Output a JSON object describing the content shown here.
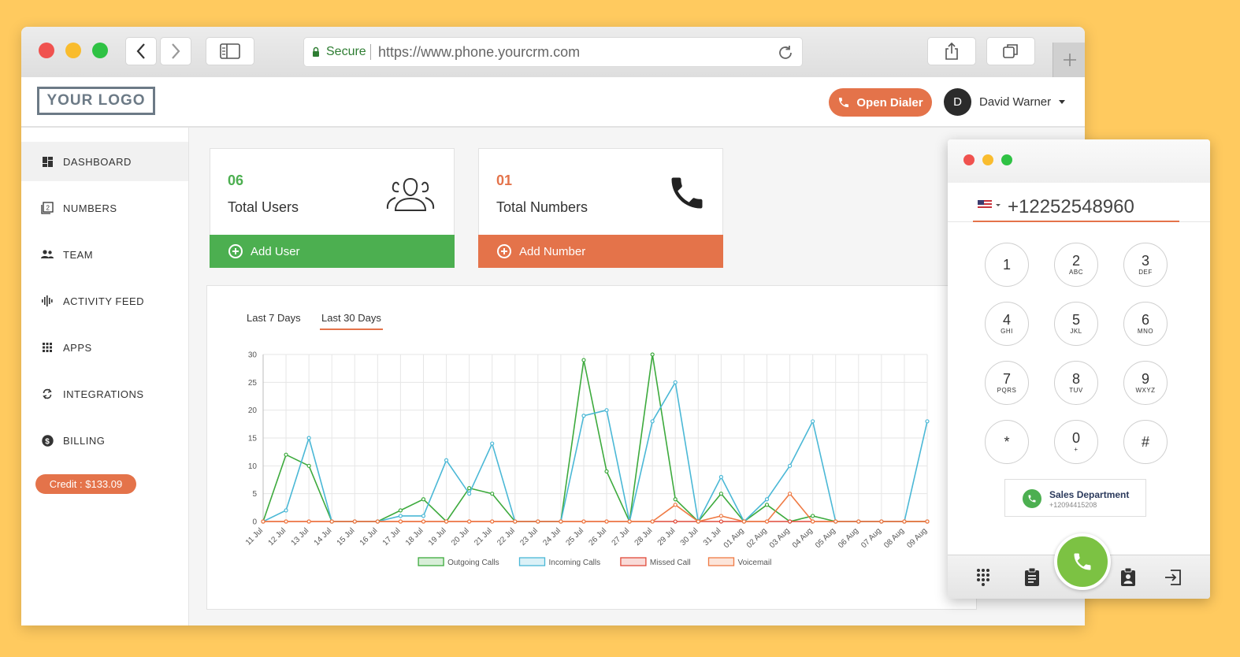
{
  "browser": {
    "secure_label": "Secure",
    "url": "https://www.phone.yourcrm.com"
  },
  "header": {
    "logo": "YOUR LOGO",
    "open_dialer": "Open Dialer",
    "avatar_initial": "D",
    "user_name": "David Warner"
  },
  "sidebar": {
    "items": [
      {
        "label": "DASHBOARD",
        "icon": "dashboard-icon"
      },
      {
        "label": "NUMBERS",
        "icon": "numbers-icon"
      },
      {
        "label": "TEAM",
        "icon": "team-icon"
      },
      {
        "label": "ACTIVITY FEED",
        "icon": "activity-icon"
      },
      {
        "label": "APPS",
        "icon": "apps-icon"
      },
      {
        "label": "INTEGRATIONS",
        "icon": "integrations-icon"
      },
      {
        "label": "BILLING",
        "icon": "billing-icon"
      }
    ],
    "credit": "Credit : $133.09"
  },
  "cards": {
    "users": {
      "count": "06",
      "label": "Total Users",
      "action": "Add User",
      "color": "#4CAF50"
    },
    "numbers": {
      "count": "01",
      "label": "Total Numbers",
      "action": "Add Number",
      "color": "#E4734A"
    }
  },
  "chart_tabs": [
    "Last 7 Days",
    "Last 30 Days"
  ],
  "chart_data": {
    "type": "line",
    "title": "",
    "xlabel": "",
    "ylabel": "",
    "ylim": [
      0,
      30
    ],
    "yticks": [
      0,
      5,
      10,
      15,
      20,
      25,
      30
    ],
    "grid": true,
    "legend": "bottom",
    "categories": [
      "11 Jul",
      "12 Jul",
      "13 Jul",
      "14 Jul",
      "15 Jul",
      "16 Jul",
      "17 Jul",
      "18 Jul",
      "19 Jul",
      "20 Jul",
      "21 Jul",
      "22 Jul",
      "23 Jul",
      "24 Jul",
      "25 Jul",
      "26 Jul",
      "27 Jul",
      "28 Jul",
      "29 Jul",
      "30 Jul",
      "31 Jul",
      "01 Aug",
      "02 Aug",
      "03 Aug",
      "04 Aug",
      "05 Aug",
      "06 Aug",
      "07 Aug",
      "08 Aug",
      "09 Aug"
    ],
    "series": [
      {
        "name": "Outgoing Calls",
        "color": "#3DAA3D",
        "values": [
          0,
          12,
          10,
          0,
          0,
          0,
          2,
          4,
          0,
          6,
          5,
          0,
          0,
          0,
          29,
          9,
          0,
          30,
          4,
          0,
          5,
          0,
          3,
          0,
          1,
          0,
          0,
          0,
          0,
          0
        ]
      },
      {
        "name": "Incoming Calls",
        "color": "#4BB8D6",
        "values": [
          0,
          2,
          15,
          0,
          0,
          0,
          1,
          1,
          11,
          5,
          14,
          0,
          0,
          0,
          19,
          20,
          0,
          18,
          25,
          0,
          8,
          0,
          4,
          10,
          18,
          0,
          0,
          0,
          0,
          18
        ]
      },
      {
        "name": "Missed Call",
        "color": "#E04A3A",
        "values": [
          0,
          0,
          0,
          0,
          0,
          0,
          0,
          0,
          0,
          0,
          0,
          0,
          0,
          0,
          0,
          0,
          0,
          0,
          0,
          0,
          0,
          0,
          0,
          0,
          0,
          0,
          0,
          0,
          0,
          0
        ]
      },
      {
        "name": "Voicemail",
        "color": "#EF7B45",
        "values": [
          0,
          0,
          0,
          0,
          0,
          0,
          0,
          0,
          0,
          0,
          0,
          0,
          0,
          0,
          0,
          0,
          0,
          0,
          3,
          0,
          1,
          0,
          0,
          5,
          0,
          0,
          0,
          0,
          0,
          0
        ]
      }
    ]
  },
  "dialer": {
    "phone": "+12252548960",
    "keys": [
      {
        "digit": "1",
        "letters": ""
      },
      {
        "digit": "2",
        "letters": "ABC"
      },
      {
        "digit": "3",
        "letters": "DEF"
      },
      {
        "digit": "4",
        "letters": "GHI"
      },
      {
        "digit": "5",
        "letters": "JKL"
      },
      {
        "digit": "6",
        "letters": "MNO"
      },
      {
        "digit": "7",
        "letters": "PQRS"
      },
      {
        "digit": "8",
        "letters": "TUV"
      },
      {
        "digit": "9",
        "letters": "WXYZ"
      },
      {
        "digit": "*",
        "letters": ""
      },
      {
        "digit": "0",
        "letters": "+"
      },
      {
        "digit": "#",
        "letters": ""
      }
    ],
    "department": "Sales Department",
    "department_number": "+12094415208"
  }
}
